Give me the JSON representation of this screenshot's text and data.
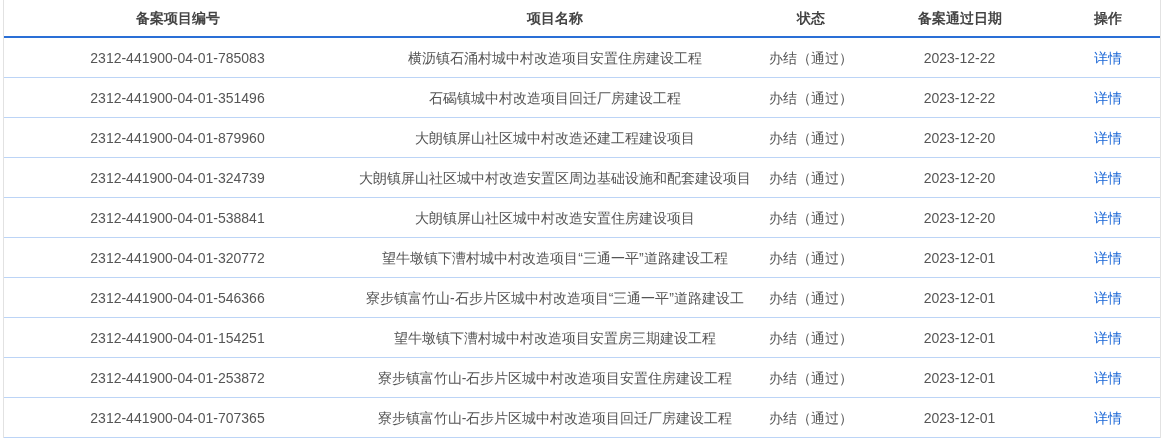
{
  "table": {
    "columns": [
      "备案项目编号",
      "项目名称",
      "状态",
      "备案通过日期",
      "操作"
    ],
    "rows": [
      {
        "code": "2312-441900-04-01-785083",
        "name": "横沥镇石涌村城中村改造项目安置住房建设工程",
        "status": "办结（通过）",
        "date": "2023-12-22",
        "action": "详情"
      },
      {
        "code": "2312-441900-04-01-351496",
        "name": "石碣镇城中村改造项目回迁厂房建设工程",
        "status": "办结（通过）",
        "date": "2023-12-22",
        "action": "详情"
      },
      {
        "code": "2312-441900-04-01-879960",
        "name": "大朗镇屏山社区城中村改造还建工程建设项目",
        "status": "办结（通过）",
        "date": "2023-12-20",
        "action": "详情"
      },
      {
        "code": "2312-441900-04-01-324739",
        "name": "大朗镇屏山社区城中村改造安置区周边基础设施和配套建设项目",
        "status": "办结（通过）",
        "date": "2023-12-20",
        "action": "详情"
      },
      {
        "code": "2312-441900-04-01-538841",
        "name": "大朗镇屏山社区城中村改造安置住房建设项目",
        "status": "办结（通过）",
        "date": "2023-12-20",
        "action": "详情"
      },
      {
        "code": "2312-441900-04-01-320772",
        "name": "望牛墩镇下漕村城中村改造项目“三通一平”道路建设工程",
        "status": "办结（通过）",
        "date": "2023-12-01",
        "action": "详情"
      },
      {
        "code": "2312-441900-04-01-546366",
        "name": "寮步镇富竹山-石步片区城中村改造项目“三通一平”道路建设工",
        "status": "办结（通过）",
        "date": "2023-12-01",
        "action": "详情"
      },
      {
        "code": "2312-441900-04-01-154251",
        "name": "望牛墩镇下漕村城中村改造项目安置房三期建设工程",
        "status": "办结（通过）",
        "date": "2023-12-01",
        "action": "详情"
      },
      {
        "code": "2312-441900-04-01-253872",
        "name": "寮步镇富竹山-石步片区城中村改造项目安置住房建设工程",
        "status": "办结（通过）",
        "date": "2023-12-01",
        "action": "详情"
      },
      {
        "code": "2312-441900-04-01-707365",
        "name": "寮步镇富竹山-石步片区城中村改造项目回迁厂房建设工程",
        "status": "办结（通过）",
        "date": "2023-12-01",
        "action": "详情"
      }
    ]
  }
}
